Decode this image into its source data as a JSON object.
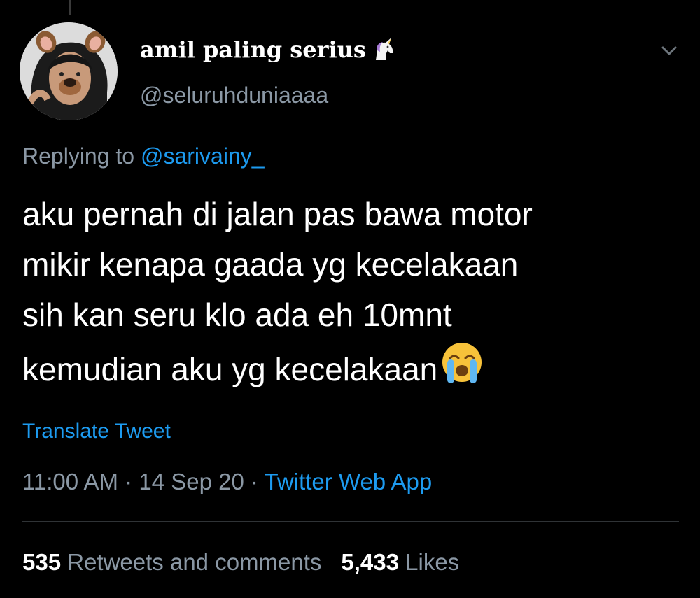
{
  "tweet": {
    "display_name": "amil paling serius",
    "name_emoji": "unicorn-icon",
    "handle": "@seluruhduniaaaa",
    "replying_prefix": "Replying to",
    "replying_to": "@sarivainy_",
    "text_lines": [
      "aku pernah di jalan pas bawa motor",
      "mikir kenapa gaada yg kecelakaan",
      "sih kan seru klo ada eh 10mnt",
      "kemudian aku yg kecelakaan"
    ],
    "text_emoji": "loudly-crying-face-icon",
    "translate_label": "Translate Tweet",
    "time": "11:00 AM",
    "separator": "·",
    "date": "14 Sep 20",
    "source": "Twitter Web App",
    "retweets_count": "535",
    "retweets_label": "Retweets and comments",
    "likes_count": "5,433",
    "likes_label": "Likes"
  },
  "colors": {
    "background": "#000000",
    "primary_text": "#ffffff",
    "secondary_text": "#8b98a5",
    "accent": "#1d9bf0",
    "divider": "#2f3336"
  }
}
